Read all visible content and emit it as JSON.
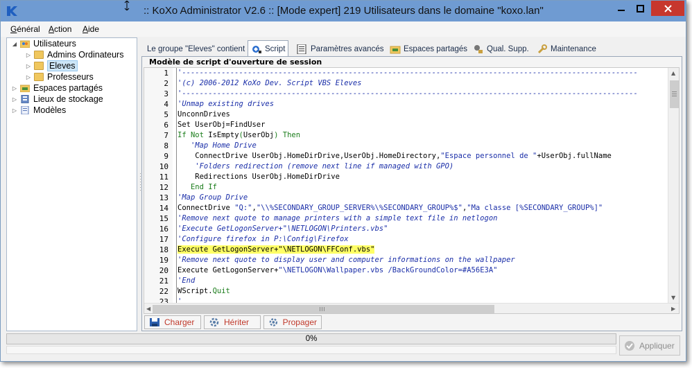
{
  "window": {
    "title": ":: KoXo Administrator V2.6 :: [Mode expert] 219 Utilisateurs dans le domaine \"koxo.lan\"",
    "logo_letter": "K",
    "min_glyph": "—",
    "max_glyph": "☐",
    "close_glyph": "✕"
  },
  "menu": [
    {
      "label": "Général",
      "underline_index": 0
    },
    {
      "label": "Action",
      "underline_index": 0
    },
    {
      "label": "Aide",
      "underline_index": 0
    }
  ],
  "tree": [
    {
      "label": "Utilisateurs",
      "expanded": true,
      "icon": "users-folder-icon"
    },
    {
      "label": "Admins Ordinateurs",
      "expanded": false,
      "icon": "folder-icon"
    },
    {
      "label": "Eleves",
      "expanded": false,
      "icon": "folder-icon",
      "selected": true
    },
    {
      "label": "Professeurs",
      "expanded": false,
      "icon": "folder-icon"
    },
    {
      "label": "Espaces partagés",
      "expanded": false,
      "icon": "shared-spaces-icon"
    },
    {
      "label": "Lieux de stockage",
      "expanded": false,
      "icon": "storage-icon"
    },
    {
      "label": "Modèles",
      "expanded": false,
      "icon": "templates-icon"
    }
  ],
  "tabs": [
    {
      "label": "Le groupe \"Eleves\" contient",
      "icon": ""
    },
    {
      "label": "Script",
      "icon": "script-icon",
      "active": true
    },
    {
      "label": "Paramètres avancés",
      "icon": "advanced-settings-icon"
    },
    {
      "label": "Espaces partagés",
      "icon": "shared-spaces-icon"
    },
    {
      "label": "Qual. Supp.",
      "icon": "qualification-icon"
    },
    {
      "label": "Maintenance",
      "icon": "maintenance-icon"
    }
  ],
  "script_panel": {
    "title": "Modèle de script d'ouverture de session",
    "highlighted_line": 18,
    "lines": [
      "'--------------------------------------------------------------------------------------------------------",
      "'(c) 2006-2012 KoXo Dev. Script VBS Eleves",
      "'--------------------------------------------------------------------------------------------------------",
      "'Unmap existing drives",
      "UnconnDrives",
      "Set UserObj=FindUser",
      "If Not IsEmpty(UserObj) Then",
      "   'Map Home Drive",
      "    ConnectDrive UserObj.HomeDirDrive,UserObj.HomeDirectory,\"Espace personnel de \"+UserObj.fullName",
      "    'Folders redirection (remove next line if managed with GPO)",
      "    Redirections UserObj.HomeDirDrive",
      "   End If",
      "'Map Group Drive",
      "ConnectDrive \"Q:\",\"\\\\%SECONDARY_GROUP_SERVER%\\%SECONDARY_GROUP%$\",\"Ma classe [%SECONDARY_GROUP%]\"",
      "'Remove next quote to manage printers with a simple text file in netlogon",
      "'Execute GetLogonServer+\"\\NETLOGON\\Printers.vbs\"",
      "'Configure firefox in P:\\Config\\Firefox",
      "Execute GetLogonServer+\"\\NETLOGON\\FFConf.vbs\"",
      "'Remove next quote to display user and computer informations on the wallpaper",
      "Execute GetLogonServer+\"\\NETLOGON\\Wallpaper.vbs /BackGroundColor=#A56E3A\"",
      "'End",
      "WScript.Quit",
      "'"
    ]
  },
  "buttons": [
    {
      "label": "Charger",
      "icon": "load-icon"
    },
    {
      "label": "Hériter",
      "icon": "inherit-icon"
    },
    {
      "label": "Propager",
      "icon": "propagate-icon"
    }
  ],
  "progress": {
    "value": 0,
    "text": "0%"
  },
  "apply": {
    "label": "Appliquer",
    "enabled": false
  },
  "colors": {
    "titlebar": "#6f9bd2",
    "close": "#c7372d",
    "comment": "#1a2ea8",
    "keyword": "#1a7c1a",
    "highlight": "#ffff66",
    "button_text": "#c0392b"
  }
}
